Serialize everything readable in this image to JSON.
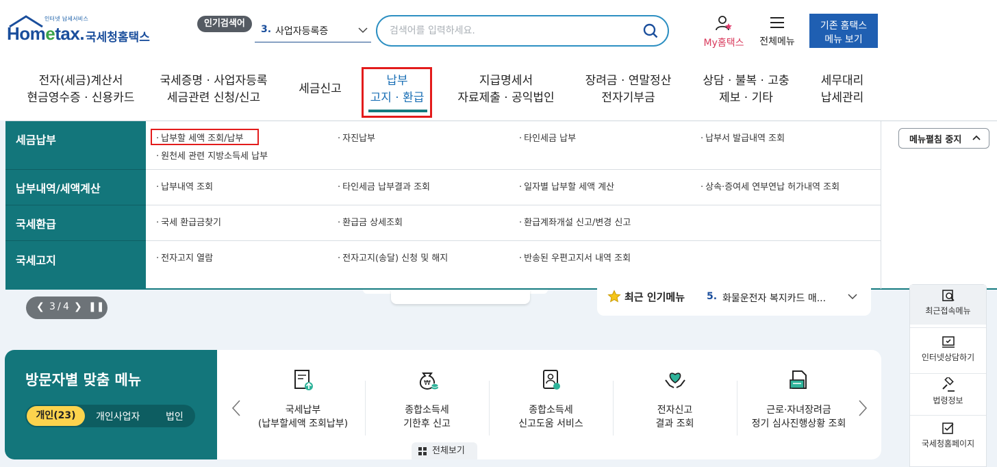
{
  "header": {
    "logo_small": "인터넷 납세서비스",
    "logo_brand_a": "Hom",
    "logo_brand_e": "e",
    "logo_brand_b": "tax.",
    "logo_korean": "국세청홈택스",
    "popular_label": "인기검색어",
    "popular_rank": "3.",
    "popular_term": "사업자등록증",
    "search_placeholder": "검색어를 입력하세요.",
    "my_hometax": "My홈택스",
    "all_menu": "전체메뉴",
    "old_hometax_line1": "기존 홈택스",
    "old_hometax_line2": "메뉴 보기"
  },
  "gnb": [
    {
      "l1": "전자(세금)계산서",
      "l2": "현금영수증 · 신용카드"
    },
    {
      "l1": "국세증명 · 사업자등록",
      "l2": "세금관련 신청/신고"
    },
    {
      "l1": "세금신고",
      "l2": ""
    },
    {
      "l1": "납부",
      "l2": "고지 · 환급"
    },
    {
      "l1": "지급명세서",
      "l2": "자료제출 · 공익법인"
    },
    {
      "l1": "장려금 · 연말정산",
      "l2": "전자기부금"
    },
    {
      "l1": "상담 · 불복 · 고충",
      "l2": "제보 · 기타"
    },
    {
      "l1": "세무대리",
      "l2": "납세관리"
    }
  ],
  "mega": {
    "stop_button": "메뉴펼침 중지",
    "rows": [
      {
        "label": "세금납부",
        "links": [
          "납부할 세액 조회/납부",
          "자진납부",
          "타인세금 납부",
          "납부서 발급내역 조회",
          "원천세 관련 지방소득세 납부"
        ]
      },
      {
        "label": "납부내역/세액계산",
        "links": [
          "납부내역 조회",
          "타인세금 납부결과 조회",
          "일자별 납부할 세액 계산",
          "상속·증여세 연부연납 허가내역 조회"
        ]
      },
      {
        "label": "국세환급",
        "links": [
          "국세 환급금찾기",
          "환급금 상세조회",
          "환급계좌개설 신고/변경 신고"
        ]
      },
      {
        "label": "국세고지",
        "links": [
          "전자고지 열람",
          "전자고지(송달) 신청 및 해지",
          "반송된 우편고지서 내역 조회"
        ]
      }
    ]
  },
  "pager": {
    "current": "3",
    "sep": "/",
    "total": "4"
  },
  "recent": {
    "title": "최근 인기메뉴",
    "rank": "5.",
    "item": "화물운전자 복지카드 매..."
  },
  "quick": [
    {
      "label": "최근접속메뉴",
      "icon": "recent-search-icon"
    },
    {
      "label": "인터넷상담하기",
      "icon": "chat-monitor-icon"
    },
    {
      "label": "법령정보",
      "icon": "gavel-icon"
    },
    {
      "label": "국세청홈페이지",
      "icon": "checklist-icon"
    }
  ],
  "visitor": {
    "title": "방문자별 맞춤 메뉴",
    "tabs": [
      "개인(23)",
      "개인사업자",
      "법인"
    ],
    "menus": [
      {
        "l1": "국세납부",
        "l2": "(납부할세액 조회납부)"
      },
      {
        "l1": "종합소득세",
        "l2": "기한후 신고"
      },
      {
        "l1": "종합소득세",
        "l2": "신고도움 서비스"
      },
      {
        "l1": "전자신고",
        "l2": "결과 조회"
      },
      {
        "l1": "근로·자녀장려금",
        "l2": "정기 심사진행상황 조회"
      }
    ],
    "all_view": "전체보기"
  },
  "colors": {
    "teal": "#13767b",
    "brand_blue": "#1a4e9c",
    "highlight_red": "#e31b1b",
    "accent_yellow": "#fcd34d"
  }
}
